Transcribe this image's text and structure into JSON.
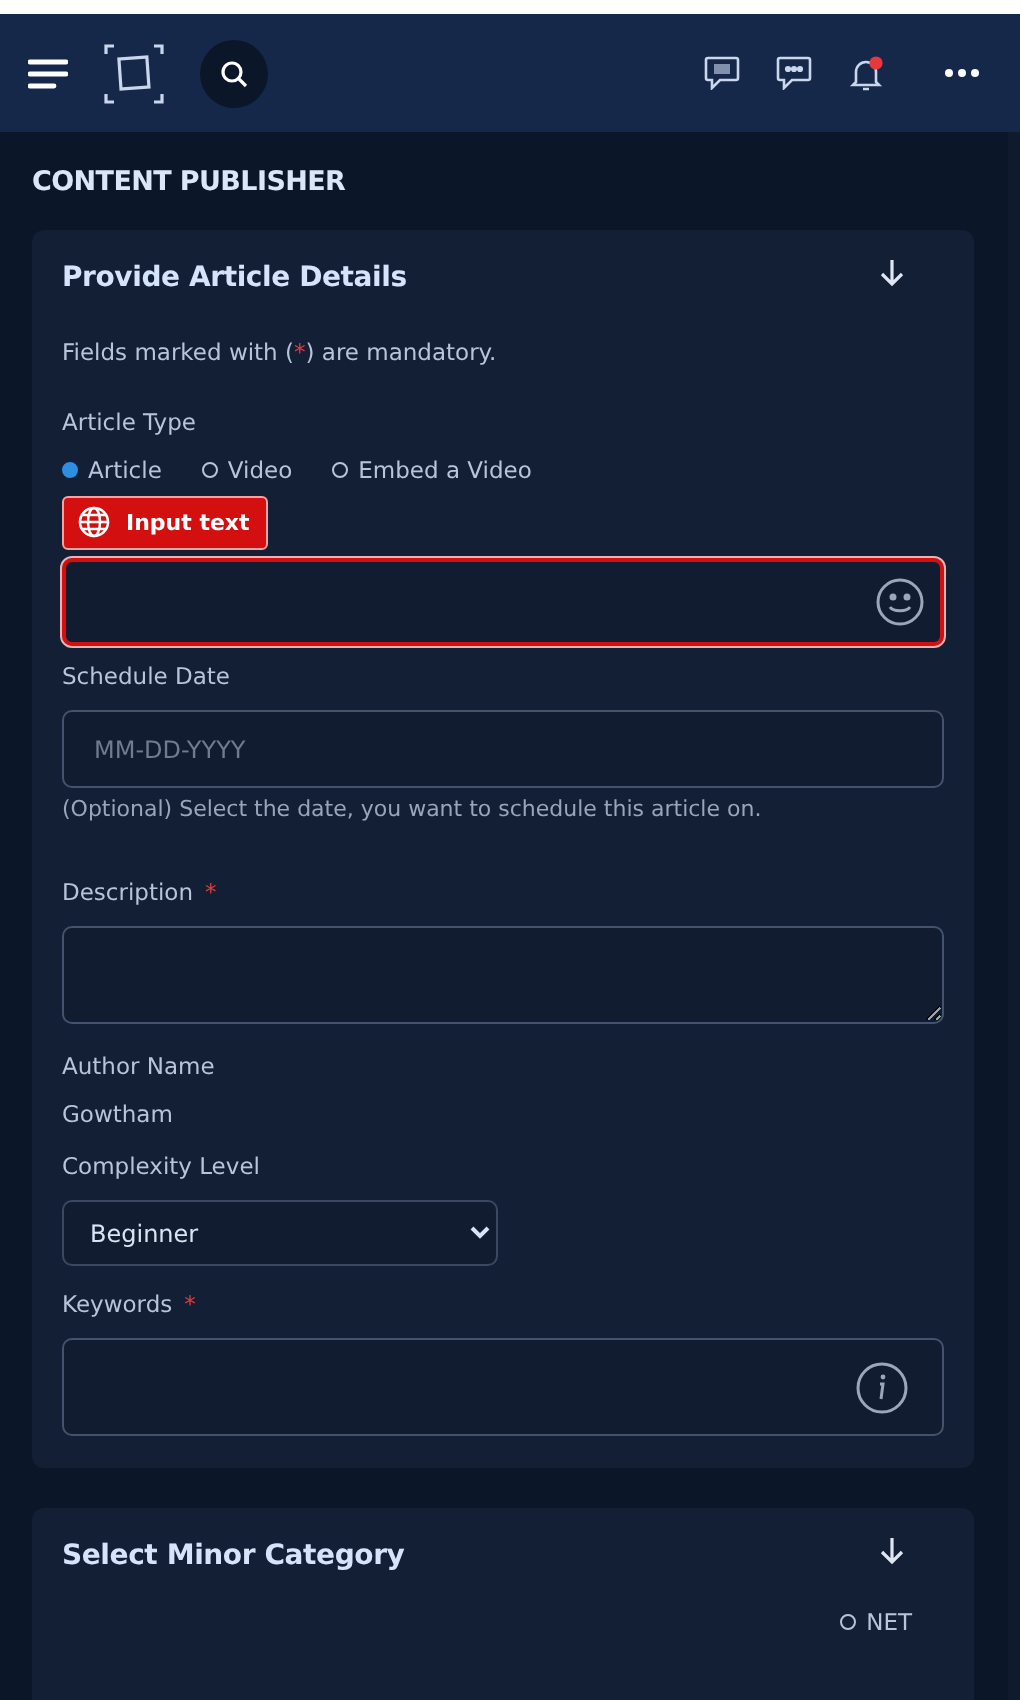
{
  "page_title": "CONTENT PUBLISHER",
  "header": {
    "notification_badge": true
  },
  "sections": [
    {
      "title": "Provide Article Details",
      "note": [
        "Fields marked with (",
        "*",
        ") are mandatory."
      ],
      "article_type": {
        "label": "Article Type",
        "options": [
          {
            "label": "Article",
            "selected": true
          },
          {
            "label": "Video",
            "selected": false
          },
          {
            "label": "Embed a Video",
            "selected": false
          }
        ]
      },
      "tooltip": "Input text",
      "schedule": {
        "label": "Schedule Date",
        "placeholder": "MM-DD-YYYY",
        "hint": "(Optional) Select the date, you want to schedule this article on."
      },
      "description": {
        "label": "Description",
        "required_mark": "*"
      },
      "author": {
        "label": "Author Name",
        "value": "Gowtham"
      },
      "complexity": {
        "label": "Complexity Level",
        "value": "Beginner"
      },
      "keywords": {
        "label": "Keywords",
        "required_mark": "*"
      }
    },
    {
      "title": "Select Minor Category",
      "options": [
        {
          "label": "NET",
          "selected": false
        }
      ]
    }
  ]
}
